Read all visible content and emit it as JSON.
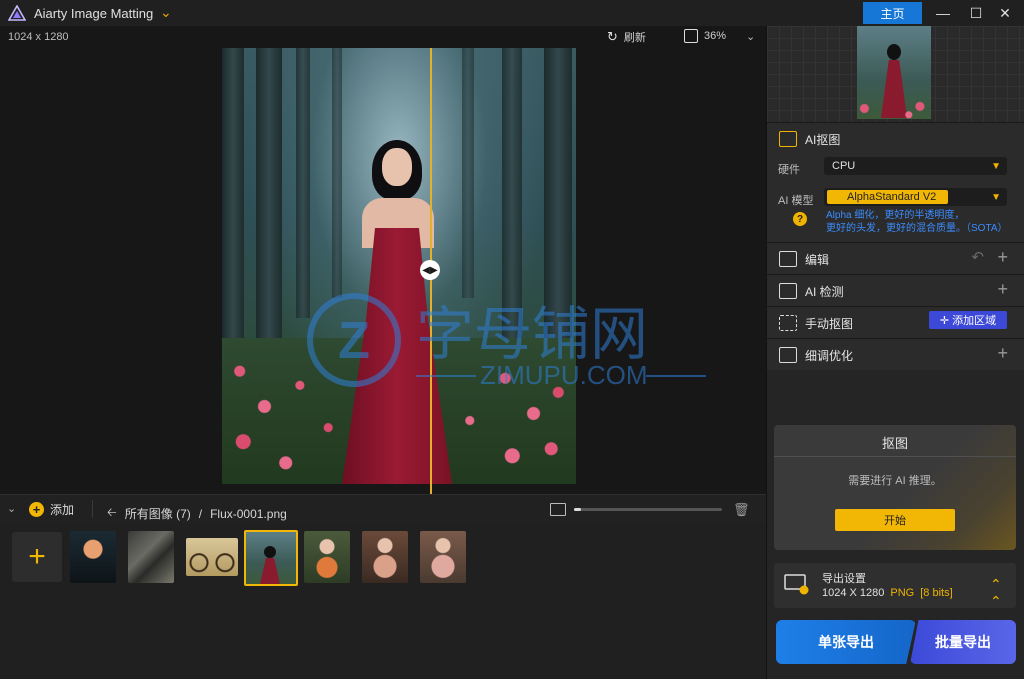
{
  "titlebar": {
    "app_title": "Aiarty Image Matting",
    "home_label": "主页",
    "icons": [
      "app-logo-icon",
      "chevron-down-icon",
      "minimize-icon",
      "maximize-icon",
      "close-icon"
    ]
  },
  "canvas": {
    "image_size": "1024 x 1280",
    "refresh_label": "刷新",
    "zoom_value": "36%",
    "watermark_cn": "字母铺网",
    "watermark_en": "ZIMUPU.COM"
  },
  "right_panel": {
    "ai_matting": {
      "title": "AI抠图",
      "hardware_label": "硬件",
      "hardware_value": "CPU",
      "model_label": "AI 模型",
      "model_value": "AlphaStandard  V2",
      "model_desc_line1": "Alpha 细化，更好的半透明度，",
      "model_desc_line2": "更好的头发，更好的混合质量。（SOTA）"
    },
    "sections": {
      "edit": "编辑",
      "ai_detect": "AI 检测",
      "manual": "手动抠图",
      "add_region": "添加区域",
      "refine": "细调优化"
    },
    "matting_card": {
      "title": "抠图",
      "message": "需要进行 AI 推理。",
      "start": "开始"
    },
    "export": {
      "title": "导出设置",
      "dimensions": "1024 X 1280",
      "format": "PNG",
      "bits": "[8 bits]",
      "single": "单张导出",
      "batch": "批量导出"
    }
  },
  "bottom_bar": {
    "add_label": "添加",
    "all_images": "所有图像 (7)",
    "separator": "/",
    "filename": "Flux-0001.png",
    "thumbnail_size": 0.05
  },
  "filmstrip": {
    "items": [
      "jellyfish",
      "rock-wood",
      "bicycle",
      "woman-red-dress-forest",
      "woman-bouquet",
      "woman-flowers-1",
      "woman-flowers-2"
    ],
    "selected_index": 3
  },
  "colors": {
    "accent": "#f2b705",
    "primary_blue": "#1677d6",
    "export_blue": "#1e7fe8",
    "batch_purple": "#3b4ad8",
    "divider": "#e3b12e"
  }
}
